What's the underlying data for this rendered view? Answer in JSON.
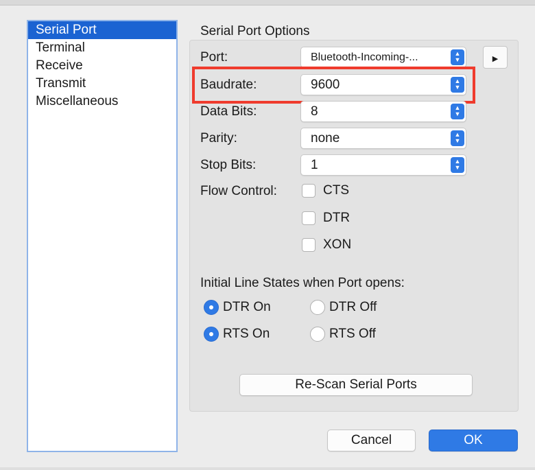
{
  "sidebar": {
    "items": [
      {
        "label": "Serial Port",
        "selected": true
      },
      {
        "label": "Terminal",
        "selected": false
      },
      {
        "label": "Receive",
        "selected": false
      },
      {
        "label": "Transmit",
        "selected": false
      },
      {
        "label": "Miscellaneous",
        "selected": false
      }
    ]
  },
  "options": {
    "title": "Serial Port Options",
    "port": {
      "label": "Port:",
      "value": "Bluetooth-Incoming-..."
    },
    "baudrate": {
      "label": "Baudrate:",
      "value": "9600"
    },
    "data_bits": {
      "label": "Data Bits:",
      "value": "8"
    },
    "parity": {
      "label": "Parity:",
      "value": "none"
    },
    "stop_bits": {
      "label": "Stop Bits:",
      "value": "1"
    },
    "flow_control": {
      "label": "Flow Control:",
      "options": [
        {
          "label": "CTS",
          "checked": false
        },
        {
          "label": "DTR",
          "checked": false
        },
        {
          "label": "XON",
          "checked": false
        }
      ]
    },
    "line_states": {
      "title": "Initial Line States when Port opens:",
      "dtr_on": "DTR On",
      "dtr_off": "DTR Off",
      "rts_on": "RTS On",
      "rts_off": "RTS Off",
      "dtr_selected": "DTR On",
      "rts_selected": "RTS On"
    },
    "rescan_label": "Re-Scan Serial Ports"
  },
  "dialog": {
    "cancel_label": "Cancel",
    "ok_label": "OK"
  },
  "icons": {
    "stepper": "up-down-chevron-icon",
    "side_button": "triangle-right-icon"
  },
  "colors": {
    "accent": "#2f7ae5",
    "selection": "#1b63d2",
    "highlight": "#ef3b2d"
  }
}
